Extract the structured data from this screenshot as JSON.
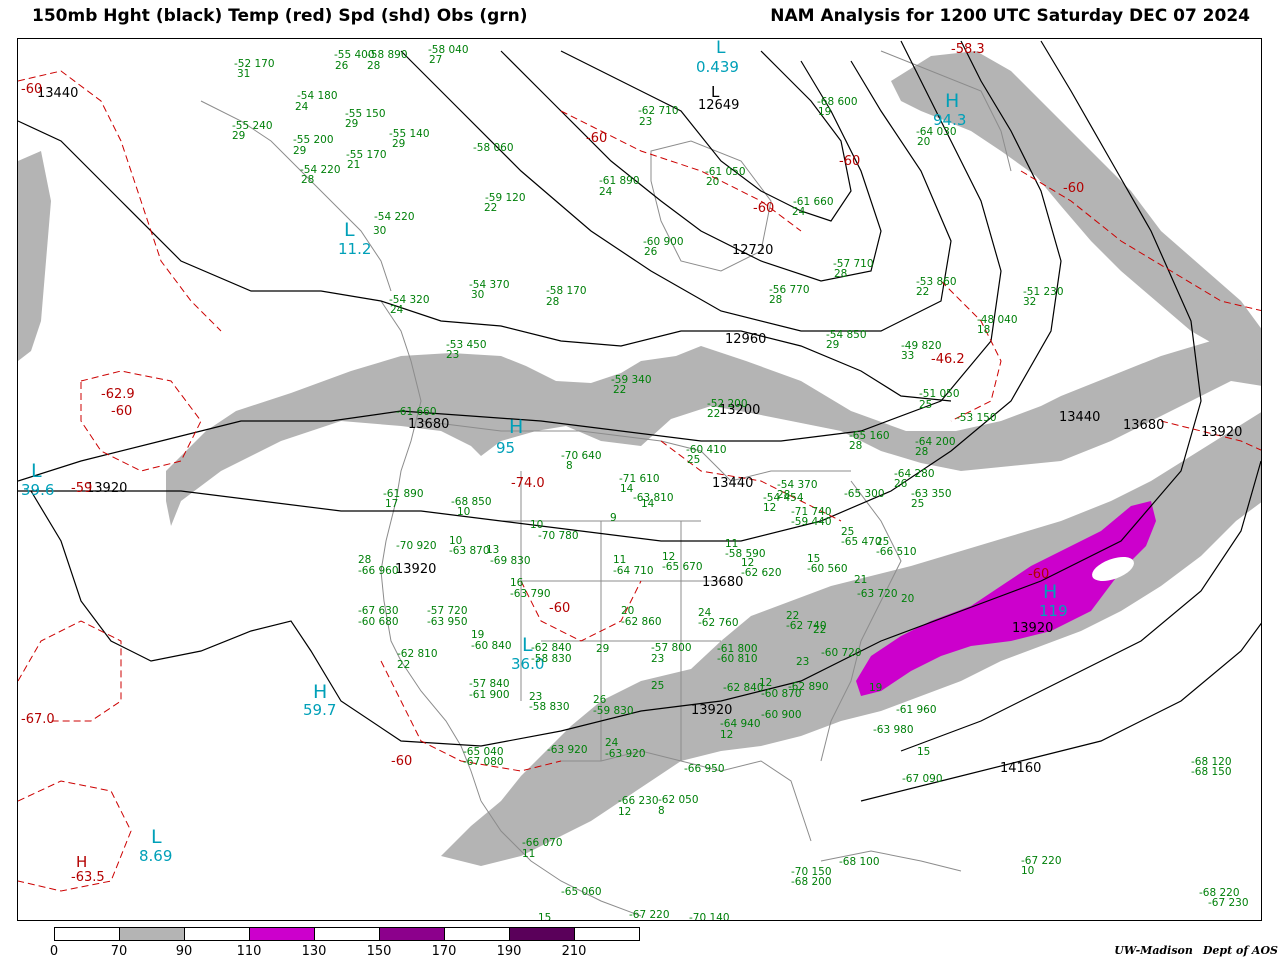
{
  "title_left": "150mb Hght (black) Temp (red) Spd (shd) Obs (grn)",
  "title_right": "NAM Analysis for 1200 UTC Saturday  DEC 07 2024",
  "credit": {
    "org": "UW-Madison",
    "dept": "Dept of AOS"
  },
  "colors": {
    "height_contour": "#000000",
    "temp_contour": "#cc0000",
    "speed_70_90": "#b4b4b4",
    "speed_110_130": "#cc00cc",
    "speed_150_170": "#8c008c",
    "speed_190_210": "#5a005a",
    "obs_text": "#00800a",
    "max_min_label": "#00a0b8",
    "map_lines": "#8c8c8c"
  },
  "legend": {
    "ticks": [
      "0",
      "70",
      "90",
      "110",
      "130",
      "150",
      "170",
      "190",
      "210"
    ]
  },
  "height_labels": [
    "13440",
    "12649",
    "12720",
    "12960",
    "13200",
    "13440",
    "13440",
    "13680",
    "13920",
    "13920",
    "13680",
    "13920",
    "13920",
    "14160",
    "13680",
    "13920"
  ],
  "temp_labels": [
    "-60",
    "-62.9",
    "-60",
    "-58.3",
    "-60",
    "-60",
    "-60",
    "-60",
    "-60",
    "-60",
    "-63.5",
    "-67.0",
    "-60",
    "-46.2",
    "-74.0",
    "-59"
  ],
  "centers": [
    {
      "type": "L",
      "value": "0.439"
    },
    {
      "type": "H",
      "value": "94.3"
    },
    {
      "type": "L",
      "value": "11.2"
    },
    {
      "type": "L",
      "value": "39.6"
    },
    {
      "type": "H",
      "value": "59.7"
    },
    {
      "type": "L",
      "value": "8.69"
    },
    {
      "type": "H",
      "value": "119"
    },
    {
      "type": "L",
      "value": "36.0"
    },
    {
      "type": "H",
      "value": "95"
    },
    {
      "type": "L",
      "value": "12649"
    },
    {
      "type": "H",
      "value": "-63.5"
    }
  ],
  "observations": [
    "-52 170",
    "31",
    "-55 400",
    "26",
    "-58 890",
    "28",
    "-58 040",
    "27",
    "-54 180",
    "24",
    "-55 150",
    "29",
    "-55 240",
    "29",
    "-55 200",
    "29",
    "-55 140",
    "29",
    "-55 170",
    "21",
    "-54 220",
    "28",
    "-58 060",
    "-62 710",
    "23",
    "-61 890",
    "24",
    "-61 050",
    "20",
    "-68 600",
    "19",
    "-64 030",
    "20",
    "-59 120",
    "22",
    "-54 220",
    "30",
    "-61 660",
    "24",
    "-60 900",
    "26",
    "-57 710",
    "28",
    "-54 370",
    "30",
    "-58 170",
    "28",
    "-56 770",
    "28",
    "-53 860",
    "22",
    "-51 230",
    "32",
    "-54 320",
    "24",
    "-53 450",
    "23",
    "-54 850",
    "29",
    "-49 820",
    "33",
    "-48 040",
    "18",
    "-59 340",
    "22",
    "-52 200",
    "22",
    "-51 050",
    "25",
    "-53 150",
    "-61 660",
    "-70 640",
    "8",
    "-60 410",
    "25",
    "-65 160",
    "28",
    "-64 200",
    "28",
    "-61 890",
    "17",
    "-68 850",
    "10",
    "-71 610",
    "14",
    "-63 810",
    "14",
    "-54 454",
    "12",
    "-54 370",
    "28",
    "-64 280",
    "26",
    "-65 300",
    "-63 350",
    "25",
    "-70 920",
    "10",
    "-63 870",
    "10",
    "-70 780",
    "9",
    "-71 740",
    "-59 440",
    "25",
    "-65 470",
    "25",
    "-66 510",
    "28",
    "-66 960",
    "13",
    "-69 830",
    "11",
    "-64 710",
    "12",
    "-65 670",
    "11",
    "-58 590",
    "12",
    "-62 620",
    "15",
    "-60 560",
    "16",
    "-63 790",
    "21",
    "-63 720",
    "20",
    "-67 630",
    "-60 680",
    "-57 720",
    "-63 950",
    "20",
    "-62 860",
    "24",
    "-62 760",
    "22",
    "-62 740",
    "22",
    "-60 720",
    "19",
    "-60 840",
    "-62 840",
    "-58 830",
    "29",
    "-57 800",
    "23",
    "-61 800",
    "-60 810",
    "23",
    "-62 810",
    "22",
    "-57 840",
    "-61 900",
    "23",
    "-58 830",
    "26",
    "-59 830",
    "25",
    "-62 840",
    "12",
    "-60 870",
    "-62 890",
    "-60 900",
    "19",
    "-61 960",
    "-63 980",
    "-65 040",
    "-67 080",
    "-63 920",
    "24",
    "-63 920",
    "-64 940",
    "12",
    "-66 950",
    "15",
    "-67 090",
    "-68 120",
    "-68 150",
    "-66 230",
    "12",
    "-62 050",
    "8",
    "-66 070",
    "11",
    "-65 060",
    "15",
    "-67 220",
    "-70 140",
    "-70 150",
    "-68 200",
    "-68 100",
    "-67 220",
    "10",
    "-68 220",
    "-67 230",
    "10",
    "-67 250",
    "8"
  ]
}
